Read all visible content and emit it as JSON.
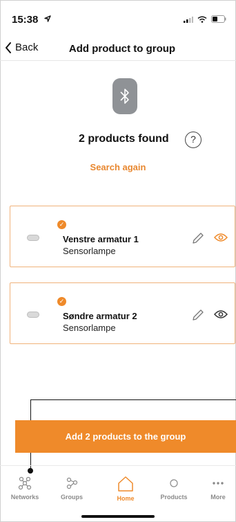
{
  "status_bar": {
    "time": "15:38"
  },
  "nav": {
    "back_label": "Back",
    "title": "Add product to group"
  },
  "discovery": {
    "found_text": "2 products found",
    "help_label": "?",
    "search_again": "Search again"
  },
  "products": [
    {
      "name": "Venstre armatur 1",
      "type": "Sensorlampe",
      "selected": true,
      "eye_color": "#ef8a2a"
    },
    {
      "name": "Søndre armatur 2",
      "type": "Sensorlampe",
      "selected": true,
      "eye_color": "#333333"
    }
  ],
  "add_button": {
    "label": "Add 2 products to the group"
  },
  "tabs": [
    {
      "label": "Networks",
      "icon": "networks-icon",
      "active": false
    },
    {
      "label": "Groups",
      "icon": "groups-icon",
      "active": false
    },
    {
      "label": "Home",
      "icon": "home-icon",
      "active": true
    },
    {
      "label": "Products",
      "icon": "products-icon",
      "active": false
    },
    {
      "label": "More",
      "icon": "more-icon",
      "active": false
    }
  ],
  "colors": {
    "accent": "#ef8a2a",
    "card_border": "#f0b27a",
    "bluetooth_badge": "#8f9296"
  }
}
